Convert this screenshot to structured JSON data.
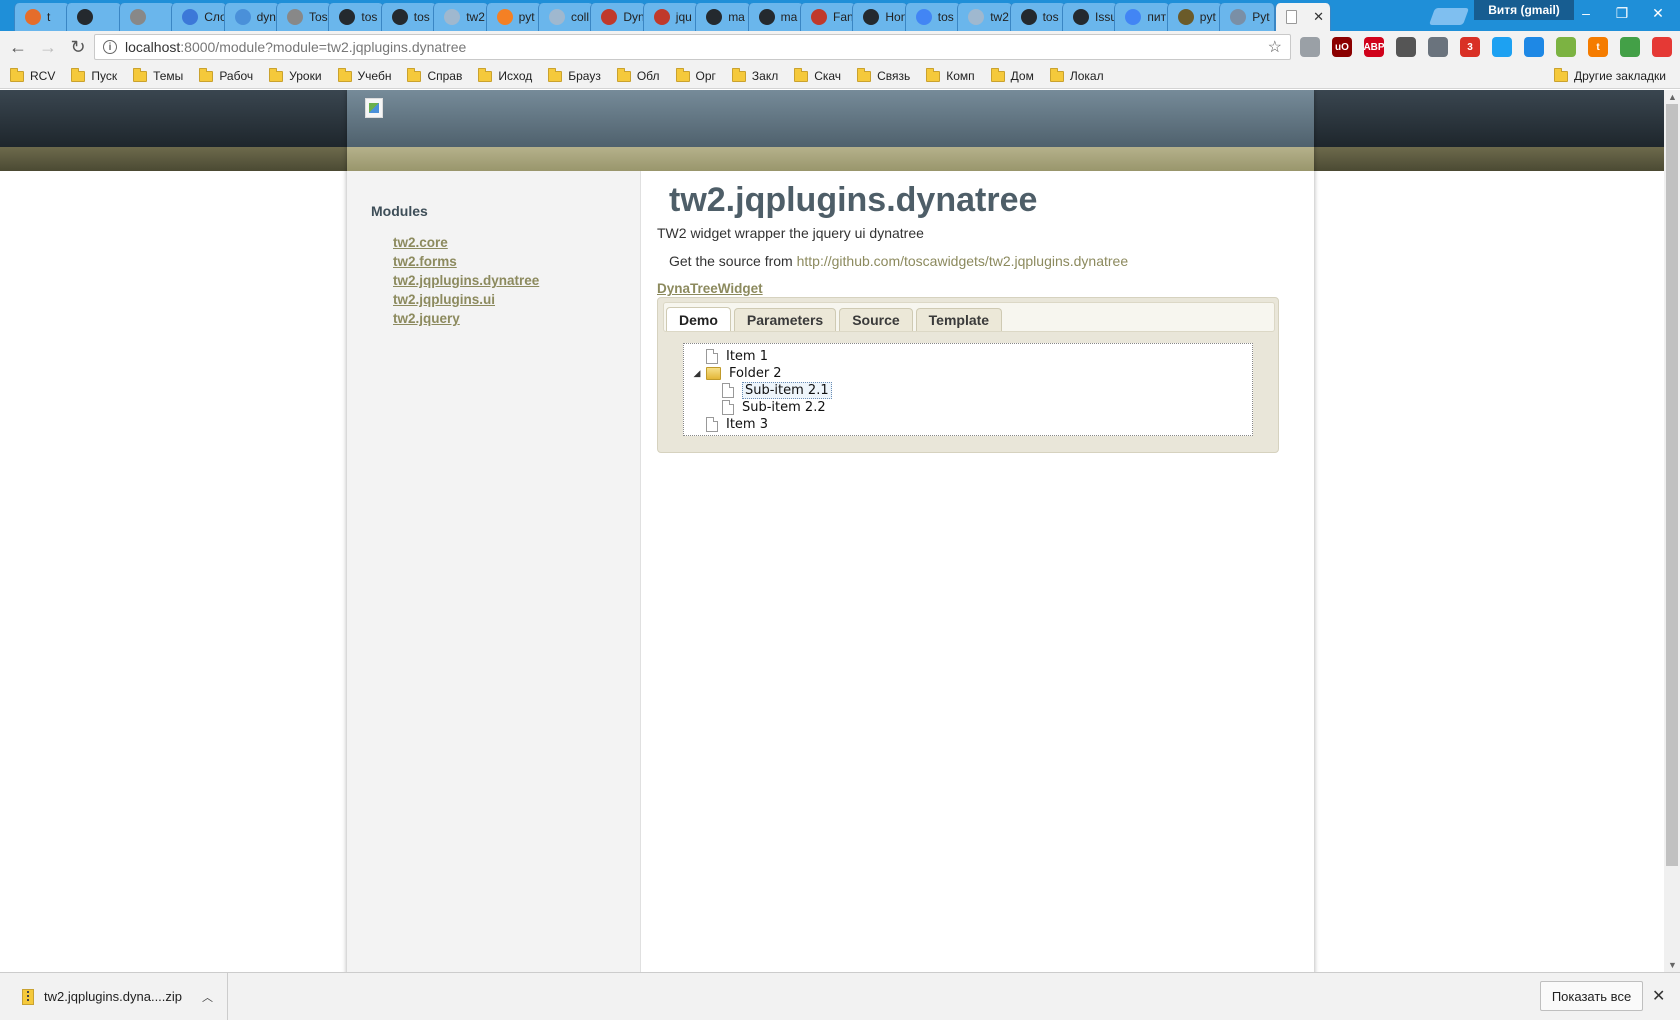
{
  "browser": {
    "tabs": [
      {
        "title": "t",
        "color": "#e56d2b"
      },
      {
        "title": "",
        "color": "#24292e"
      },
      {
        "title": "",
        "color": "#888888"
      },
      {
        "title": "Сло",
        "color": "#3c78d8"
      },
      {
        "title": "dyn",
        "color": "#4a90d9"
      },
      {
        "title": "Tos",
        "color": "#888888"
      },
      {
        "title": "tos",
        "color": "#24292e"
      },
      {
        "title": "tos",
        "color": "#24292e"
      },
      {
        "title": "tw2",
        "color": "#9fb8cf"
      },
      {
        "title": "pyt",
        "color": "#f48024"
      },
      {
        "title": "coll",
        "color": "#9fb8cf"
      },
      {
        "title": "Dyn",
        "color": "#c0392b"
      },
      {
        "title": "jqu",
        "color": "#c0392b"
      },
      {
        "title": "ma",
        "color": "#24292e"
      },
      {
        "title": "ma",
        "color": "#24292e"
      },
      {
        "title": "Fan",
        "color": "#c0392b"
      },
      {
        "title": "Hon",
        "color": "#24292e"
      },
      {
        "title": "tos",
        "color": "#4285f4"
      },
      {
        "title": "tw2",
        "color": "#9fb8cf"
      },
      {
        "title": "tos",
        "color": "#24292e"
      },
      {
        "title": "Issu",
        "color": "#24292e"
      },
      {
        "title": "пит",
        "color": "#4285f4"
      },
      {
        "title": "pyt",
        "color": "#6b5b2a"
      },
      {
        "title": "Pyt",
        "color": "#7a8fa6"
      }
    ],
    "profile": "Витя (gmail)",
    "url_host": "localhost",
    "url_path": ":8000/module?module=tw2.jqplugins.dynatree",
    "bookmarks": [
      "RCV",
      "Пуск",
      "Темы",
      "Рабоч",
      "Уроки",
      "Учебн",
      "Справ",
      "Исход",
      "Брауз",
      "Обл",
      "Орг",
      "Закл",
      "Скач",
      "Связь",
      "Комп",
      "Дом",
      "Локал"
    ],
    "other_bookmarks": "Другие закладки",
    "extensions": [
      {
        "label": "",
        "color": "#9aa0a6"
      },
      {
        "label": "uO",
        "color": "#8b0000"
      },
      {
        "label": "ABP",
        "color": "#d0021b"
      },
      {
        "label": "",
        "color": "#555555"
      },
      {
        "label": "",
        "color": "#6a737d"
      },
      {
        "label": "3",
        "color": "#d93025"
      },
      {
        "label": "",
        "color": "#1da1f2"
      },
      {
        "label": "",
        "color": "#1e88e5"
      },
      {
        "label": "",
        "color": "#7cb342"
      },
      {
        "label": "t",
        "color": "#f57c00"
      },
      {
        "label": "",
        "color": "#43a047"
      },
      {
        "label": "",
        "color": "#e53935"
      }
    ]
  },
  "page": {
    "sidebar_heading": "Modules",
    "modules": [
      "tw2.core",
      "tw2.forms",
      "tw2.jqplugins.dynatree",
      "tw2.jqplugins.ui",
      "tw2.jquery"
    ],
    "title": "tw2.jqplugins.dynatree",
    "description": "TW2 widget wrapper the jquery ui dynatree",
    "source_prefix": "Get the source from",
    "source_url": "http://github.com/toscawidgets/tw2.jqplugins.dynatree",
    "widget_name": "DynaTreeWidget",
    "widget_tabs": [
      "Demo",
      "Parameters",
      "Source",
      "Template"
    ],
    "selected_tab": "Demo",
    "tree": {
      "item1": "Item 1",
      "folder2": "Folder 2",
      "sub21": "Sub-item 2.1",
      "sub22": "Sub-item 2.2",
      "item3": "Item 3"
    }
  },
  "downloads": {
    "file": "tw2.jqplugins.dyna....zip",
    "show_all": "Показать все"
  }
}
